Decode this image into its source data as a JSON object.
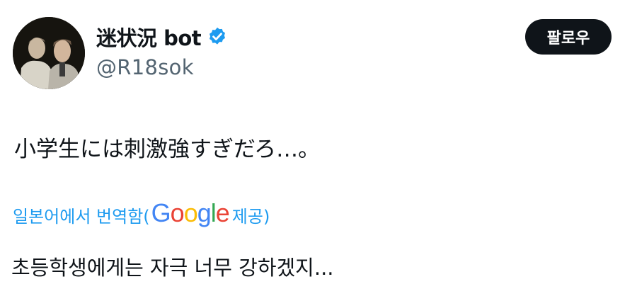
{
  "author": {
    "display_name": "迷状況 bot",
    "handle": "@R18sok",
    "verified": true,
    "avatar_icon": "user-avatar",
    "verified_icon": "verified-badge-icon"
  },
  "follow_button": {
    "label": "팔로우"
  },
  "tweet": {
    "text": "小学生には刺激強すぎだろ…。"
  },
  "translation": {
    "label_prefix": "일본어에서 번역함(",
    "provider_logo_letters": [
      "G",
      "o",
      "o",
      "g",
      "l",
      "e"
    ],
    "label_suffix": " 제공)",
    "translated_text": "초등학생에게는 자극 너무 강하겠지..."
  },
  "colors": {
    "text": "#0f1419",
    "secondary": "#536471",
    "link": "#1d9bf0",
    "button_bg": "#0f1419",
    "verified": "#1d9bf0"
  }
}
